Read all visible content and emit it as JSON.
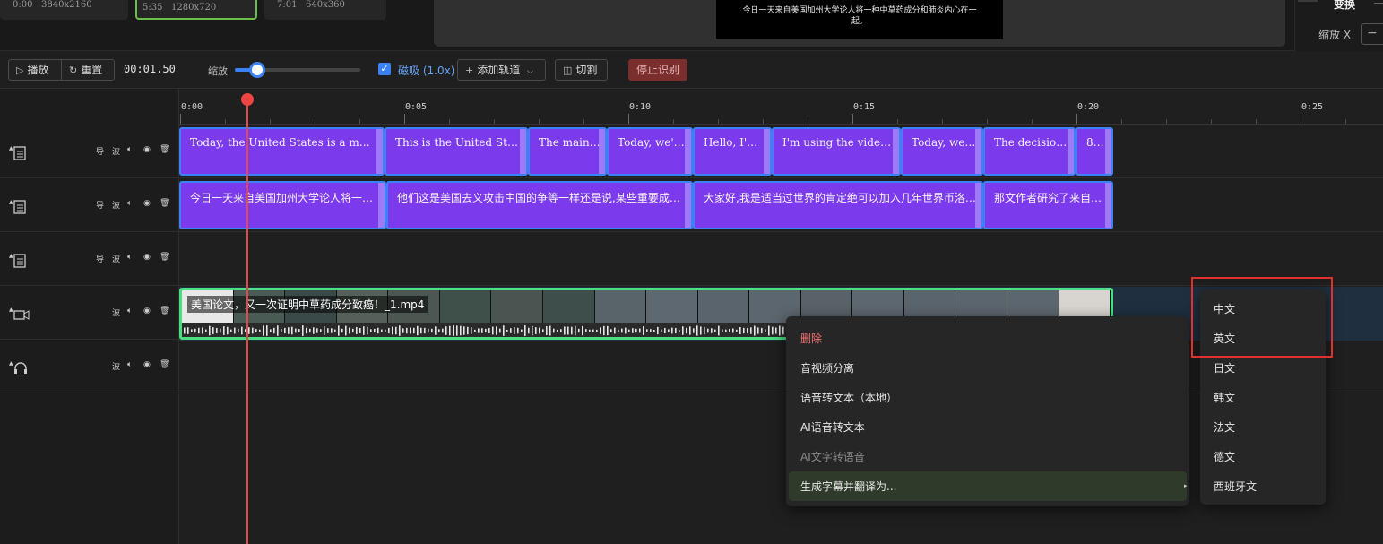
{
  "top": {
    "resolutions": [
      {
        "duration": "0:00",
        "size": "3840x2160"
      },
      {
        "duration": "5:35",
        "size": "1280x720"
      },
      {
        "duration": "7:01",
        "size": "640x360"
      }
    ],
    "preview_subtitle": "今日一天来自美国加州大学论人将一种中草药成分和肺炎内心在一起。",
    "transform_label": "变换",
    "scale_x_label": "缩放 X",
    "scale_x_minus": "−"
  },
  "toolbar": {
    "play_label": "播放",
    "reset_label": "重置",
    "timecode": "00:01.50",
    "zoom_label": "缩放",
    "zoom_fraction": 0.18,
    "snap_checked": true,
    "snap_label": "磁吸 (1.0x)",
    "add_track_label": "添加轨道",
    "split_label": "切割",
    "stop_label": "停止识别"
  },
  "ruler": {
    "labels": [
      "0:00",
      "0:05",
      "0:10",
      "0:15",
      "0:20",
      "0:25"
    ]
  },
  "track_controls": {
    "export": "导",
    "wave": "波",
    "speaker_icon": "speaker-icon",
    "eye_icon": "eye-icon",
    "trash_icon": "trash-icon"
  },
  "tracks": {
    "english_clips": [
      "Today, the United States is a major role i…",
      "This is the United States's …",
      "The main g…",
      "Today, we're …",
      "Hello, I'm …",
      "I'm using the video of t…",
      "Today, we'r…",
      "The decision i…",
      "8…"
    ],
    "chinese_clips": [
      "今日一天来自美国加州大学论人将一…",
      "他们这是美国去义攻击中国的争等一样还是说,某些重要成…",
      "大家好,我是适当过世界的肯定绝可以加入几年世界币洛…",
      "那文作者研究了来自…"
    ],
    "video_clip_label": "美国论文，又一次证明中草药成分致癌！_1.mp4"
  },
  "context_menu": {
    "items": [
      "删除",
      "音视频分离",
      "语音转文本（本地）",
      "AI语音转文本",
      "AI文字转语音",
      "生成字幕并翻译为..."
    ]
  },
  "language_menu": {
    "items": [
      "中文",
      "英文",
      "日文",
      "韩文",
      "法文",
      "德文",
      "西班牙文"
    ]
  },
  "colors": {
    "clip_purple": "#7c3aed",
    "clip_border": "#3b82f6",
    "playhead": "#ef4444",
    "video_border": "#4ade80",
    "highlight_box": "#e03131"
  }
}
